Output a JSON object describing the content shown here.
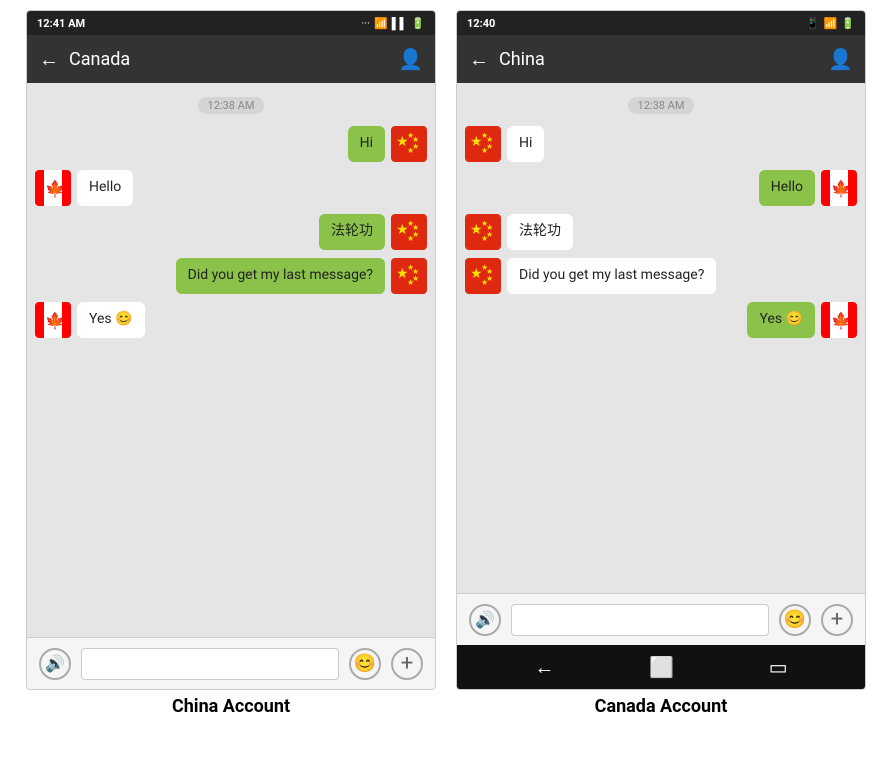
{
  "left_phone": {
    "status_bar": {
      "time": "12:41 AM",
      "icons": "... ☁ ▲ ▌▌ 🔋"
    },
    "app_bar": {
      "title": "Canada",
      "back_label": "←",
      "contact_icon": "👤"
    },
    "timestamp": "12:38 AM",
    "messages": [
      {
        "id": 1,
        "text": "Hi",
        "type": "sent",
        "flag": "china"
      },
      {
        "id": 2,
        "text": "Hello",
        "type": "received",
        "flag": "canada"
      },
      {
        "id": 3,
        "text": "法轮功",
        "type": "sent",
        "flag": "china"
      },
      {
        "id": 4,
        "text": "Did you get my last message?",
        "type": "sent",
        "flag": "china"
      },
      {
        "id": 5,
        "text": "Yes 😊",
        "type": "received",
        "flag": "canada"
      }
    ],
    "bottom_bar": {
      "voice_icon": "🔊",
      "emoji_icon": "😊",
      "add_icon": "+"
    },
    "caption": "China Account"
  },
  "right_phone": {
    "status_bar": {
      "time": "12:40",
      "icons": "📱 ☁ ▲ 🔋"
    },
    "app_bar": {
      "title": "China",
      "back_label": "←",
      "contact_icon": "👤"
    },
    "timestamp": "12:38 AM",
    "messages": [
      {
        "id": 1,
        "text": "Hi",
        "type": "received",
        "flag": "china"
      },
      {
        "id": 2,
        "text": "Hello",
        "type": "sent",
        "flag": "canada"
      },
      {
        "id": 3,
        "text": "法轮功",
        "type": "received",
        "flag": "china"
      },
      {
        "id": 4,
        "text": "Did you get my last message?",
        "type": "received",
        "flag": "china"
      },
      {
        "id": 5,
        "text": "Yes 😊",
        "type": "sent",
        "flag": "canada"
      }
    ],
    "bottom_bar": {
      "voice_icon": "🔊",
      "emoji_icon": "😊",
      "add_icon": "+"
    },
    "android_nav": {
      "back": "←",
      "home": "⬜",
      "recents": "▭"
    },
    "caption": "Canada Account"
  }
}
